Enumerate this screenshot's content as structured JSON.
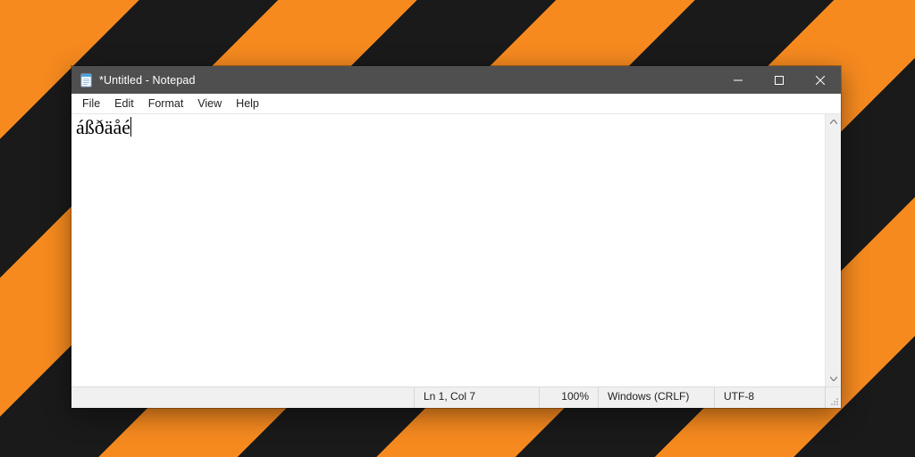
{
  "window": {
    "title": "*Untitled - Notepad"
  },
  "menubar": {
    "items": [
      "File",
      "Edit",
      "Format",
      "View",
      "Help"
    ]
  },
  "editor": {
    "content": "áßðäåé"
  },
  "statusbar": {
    "lncol": "Ln 1, Col 7",
    "zoom": "100%",
    "eol": "Windows (CRLF)",
    "encoding": "UTF-8"
  }
}
